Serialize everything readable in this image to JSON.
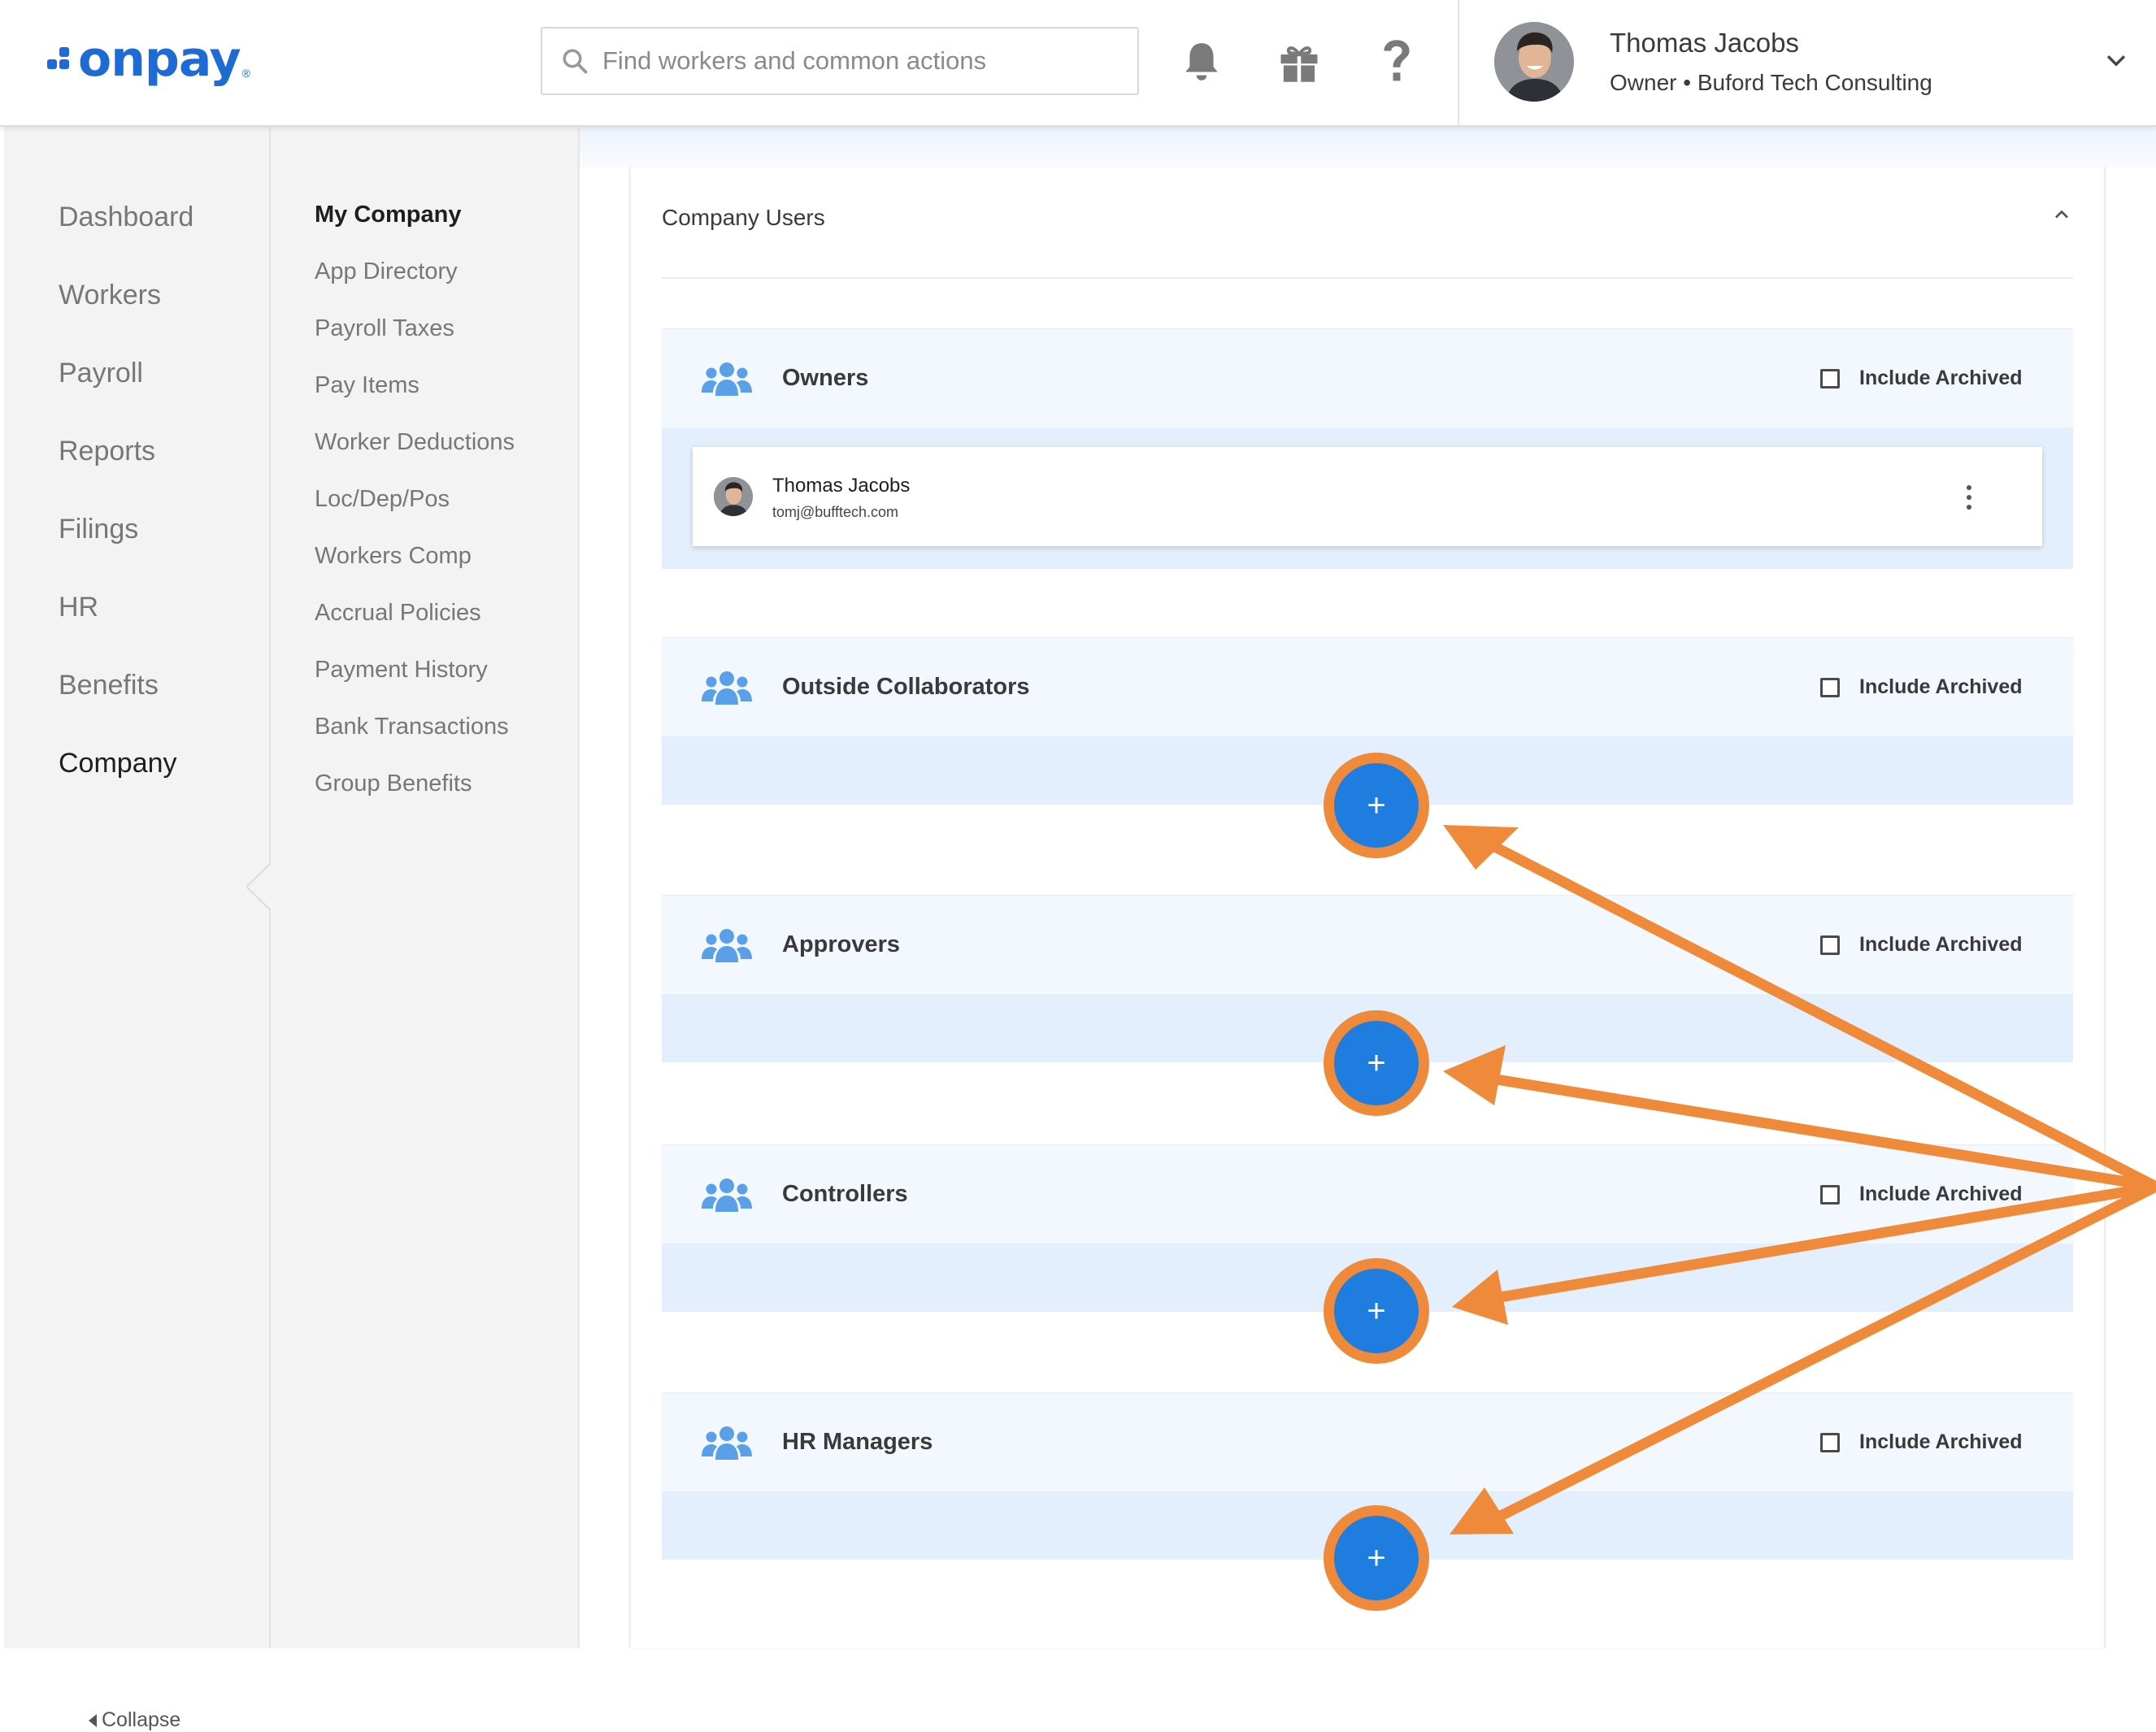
{
  "brand": {
    "name": "onpay",
    "color": "#1f6bd6",
    "accent_orange": "#ef8a3b",
    "button_blue": "#1f7ddf"
  },
  "header": {
    "search_placeholder": "Find workers and common actions",
    "icons": [
      "bell-icon",
      "gift-icon",
      "help-icon"
    ],
    "user": {
      "name": "Thomas Jacobs",
      "role": "Owner • Buford Tech Consulting"
    }
  },
  "sidebar": {
    "items": [
      {
        "label": "Dashboard"
      },
      {
        "label": "Workers"
      },
      {
        "label": "Payroll"
      },
      {
        "label": "Reports"
      },
      {
        "label": "Filings"
      },
      {
        "label": "HR"
      },
      {
        "label": "Benefits"
      },
      {
        "label": "Company",
        "active": true
      }
    ],
    "collapse_label": "Collapse"
  },
  "subnav": {
    "items": [
      {
        "label": "My Company",
        "active": true
      },
      {
        "label": "App Directory"
      },
      {
        "label": "Payroll Taxes"
      },
      {
        "label": "Pay Items"
      },
      {
        "label": "Worker Deductions"
      },
      {
        "label": "Loc/Dep/Pos"
      },
      {
        "label": "Workers Comp"
      },
      {
        "label": "Accrual Policies"
      },
      {
        "label": "Payment History"
      },
      {
        "label": "Bank Transactions"
      },
      {
        "label": "Group Benefits"
      }
    ]
  },
  "main": {
    "panel_title": "Company Users",
    "include_archived_label": "Include Archived",
    "add_label": "+",
    "groups": [
      {
        "title": "Owners",
        "users": [
          {
            "name": "Thomas Jacobs",
            "email": "tomj@bufftech.com"
          }
        ]
      },
      {
        "title": "Outside Collaborators",
        "users": []
      },
      {
        "title": "Approvers",
        "users": []
      },
      {
        "title": "Controllers",
        "users": []
      },
      {
        "title": "HR Managers",
        "users": []
      }
    ]
  }
}
